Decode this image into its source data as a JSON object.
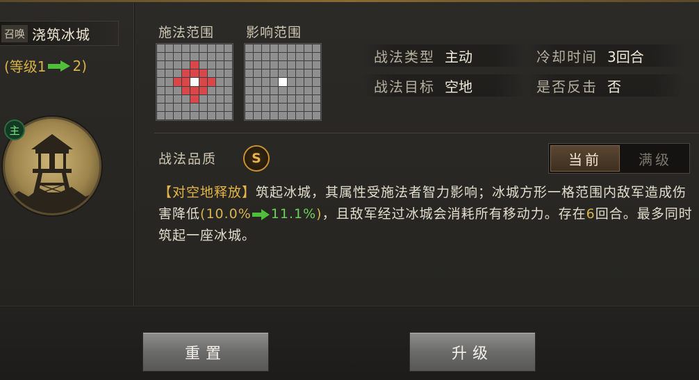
{
  "skill": {
    "summon_tag": "召唤",
    "name": "浇筑冰城",
    "level_prefix": "(等级1",
    "level_suffix": "2)",
    "main_badge": "主"
  },
  "ranges": {
    "cast_label": "施法范围",
    "effect_label": "影响范围",
    "cast_grid": [
      "000000000",
      "000000000",
      "000010000",
      "000111000",
      "001121100",
      "000111000",
      "000010000",
      "000000000",
      "000000000"
    ],
    "effect_grid": [
      "000000000",
      "000000000",
      "000000000",
      "000000000",
      "000020000",
      "000000000",
      "000000000",
      "000000000",
      "000000000"
    ]
  },
  "info": {
    "type_key": "战法类型",
    "type_val": "主动",
    "cooldown_key": "冷却时间",
    "cooldown_val": "3回合",
    "target_key": "战法目标",
    "target_val": "空地",
    "counter_key": "是否反击",
    "counter_val": "否"
  },
  "quality": {
    "label": "战法品质",
    "grade": "S"
  },
  "toggle": {
    "current": "当前",
    "max": "满级"
  },
  "description": {
    "tag": "【对空地释放】",
    "part1": "筑起冰城，其属性受施法者智力影响；冰城方形一格范围内敌军造成伤害降低",
    "open_paren": "(",
    "val_from": "10.0%",
    "val_to": "11.1%",
    "close_paren": ")",
    "part2": "，且敌军经过冰城会消耗所有移动力。存在",
    "turns": "6",
    "part3": "回合。最多同时筑起一座冰城。"
  },
  "buttons": {
    "reset": "重置",
    "upgrade": "升级"
  },
  "colors": {
    "accent_gold": "#d6b24a",
    "increase_green": "#4fbf3a",
    "range_red": "#d9474b"
  }
}
